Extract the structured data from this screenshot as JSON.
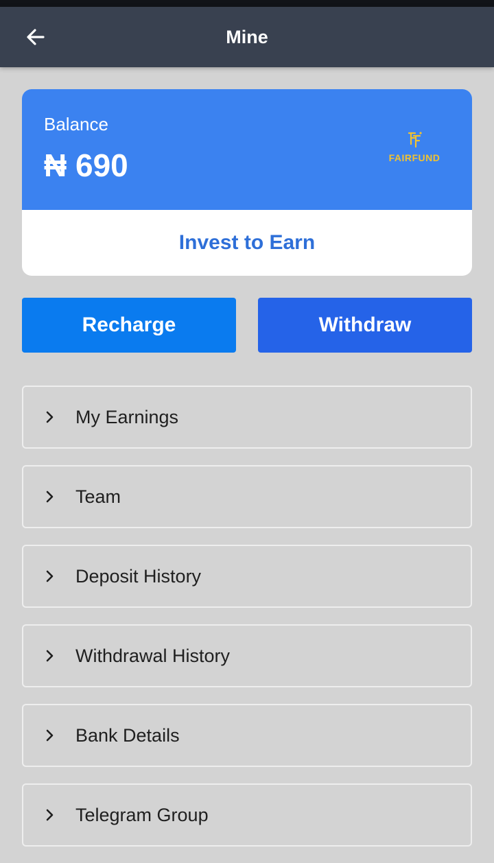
{
  "header": {
    "title": "Mine",
    "back_icon": "arrow-left-icon"
  },
  "balance": {
    "label": "Balance",
    "amount": "₦ 690",
    "logo_text": "FAIRFUND",
    "logo_icon": "fairfund-logo-icon",
    "invest_label": "Invest to Earn"
  },
  "actions": {
    "recharge_label": "Recharge",
    "withdraw_label": "Withdraw"
  },
  "menu": [
    {
      "label": "My Earnings",
      "icon": "chevron-right-icon"
    },
    {
      "label": "Team",
      "icon": "chevron-right-icon"
    },
    {
      "label": "Deposit History",
      "icon": "chevron-right-icon"
    },
    {
      "label": "Withdrawal History",
      "icon": "chevron-right-icon"
    },
    {
      "label": "Bank Details",
      "icon": "chevron-right-icon"
    },
    {
      "label": "Telegram Group",
      "icon": "chevron-right-icon"
    }
  ],
  "colors": {
    "header_bg": "#394150",
    "balance_card": "#3b82f0",
    "recharge_button": "#0a7bef",
    "withdraw_button": "#2563e8",
    "invest_text": "#2e6fd8",
    "logo_gold": "#f2c230",
    "page_bg": "#d3d3d3"
  }
}
